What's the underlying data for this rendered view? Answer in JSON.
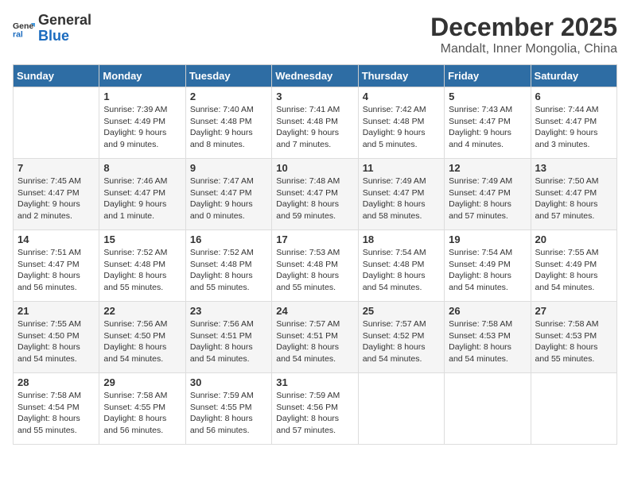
{
  "logo": {
    "general": "General",
    "blue": "Blue"
  },
  "title": "December 2025",
  "subtitle": "Mandalt, Inner Mongolia, China",
  "days_of_week": [
    "Sunday",
    "Monday",
    "Tuesday",
    "Wednesday",
    "Thursday",
    "Friday",
    "Saturday"
  ],
  "weeks": [
    [
      {
        "day": "",
        "info": ""
      },
      {
        "day": "1",
        "sunrise": "7:39 AM",
        "sunset": "4:49 PM",
        "daylight": "9 hours and 9 minutes."
      },
      {
        "day": "2",
        "sunrise": "7:40 AM",
        "sunset": "4:48 PM",
        "daylight": "9 hours and 8 minutes."
      },
      {
        "day": "3",
        "sunrise": "7:41 AM",
        "sunset": "4:48 PM",
        "daylight": "9 hours and 7 minutes."
      },
      {
        "day": "4",
        "sunrise": "7:42 AM",
        "sunset": "4:48 PM",
        "daylight": "9 hours and 5 minutes."
      },
      {
        "day": "5",
        "sunrise": "7:43 AM",
        "sunset": "4:47 PM",
        "daylight": "9 hours and 4 minutes."
      },
      {
        "day": "6",
        "sunrise": "7:44 AM",
        "sunset": "4:47 PM",
        "daylight": "9 hours and 3 minutes."
      }
    ],
    [
      {
        "day": "7",
        "sunrise": "7:45 AM",
        "sunset": "4:47 PM",
        "daylight": "9 hours and 2 minutes."
      },
      {
        "day": "8",
        "sunrise": "7:46 AM",
        "sunset": "4:47 PM",
        "daylight": "9 hours and 1 minute."
      },
      {
        "day": "9",
        "sunrise": "7:47 AM",
        "sunset": "4:47 PM",
        "daylight": "9 hours and 0 minutes."
      },
      {
        "day": "10",
        "sunrise": "7:48 AM",
        "sunset": "4:47 PM",
        "daylight": "8 hours and 59 minutes."
      },
      {
        "day": "11",
        "sunrise": "7:49 AM",
        "sunset": "4:47 PM",
        "daylight": "8 hours and 58 minutes."
      },
      {
        "day": "12",
        "sunrise": "7:49 AM",
        "sunset": "4:47 PM",
        "daylight": "8 hours and 57 minutes."
      },
      {
        "day": "13",
        "sunrise": "7:50 AM",
        "sunset": "4:47 PM",
        "daylight": "8 hours and 57 minutes."
      }
    ],
    [
      {
        "day": "14",
        "sunrise": "7:51 AM",
        "sunset": "4:47 PM",
        "daylight": "8 hours and 56 minutes."
      },
      {
        "day": "15",
        "sunrise": "7:52 AM",
        "sunset": "4:48 PM",
        "daylight": "8 hours and 55 minutes."
      },
      {
        "day": "16",
        "sunrise": "7:52 AM",
        "sunset": "4:48 PM",
        "daylight": "8 hours and 55 minutes."
      },
      {
        "day": "17",
        "sunrise": "7:53 AM",
        "sunset": "4:48 PM",
        "daylight": "8 hours and 55 minutes."
      },
      {
        "day": "18",
        "sunrise": "7:54 AM",
        "sunset": "4:48 PM",
        "daylight": "8 hours and 54 minutes."
      },
      {
        "day": "19",
        "sunrise": "7:54 AM",
        "sunset": "4:49 PM",
        "daylight": "8 hours and 54 minutes."
      },
      {
        "day": "20",
        "sunrise": "7:55 AM",
        "sunset": "4:49 PM",
        "daylight": "8 hours and 54 minutes."
      }
    ],
    [
      {
        "day": "21",
        "sunrise": "7:55 AM",
        "sunset": "4:50 PM",
        "daylight": "8 hours and 54 minutes."
      },
      {
        "day": "22",
        "sunrise": "7:56 AM",
        "sunset": "4:50 PM",
        "daylight": "8 hours and 54 minutes."
      },
      {
        "day": "23",
        "sunrise": "7:56 AM",
        "sunset": "4:51 PM",
        "daylight": "8 hours and 54 minutes."
      },
      {
        "day": "24",
        "sunrise": "7:57 AM",
        "sunset": "4:51 PM",
        "daylight": "8 hours and 54 minutes."
      },
      {
        "day": "25",
        "sunrise": "7:57 AM",
        "sunset": "4:52 PM",
        "daylight": "8 hours and 54 minutes."
      },
      {
        "day": "26",
        "sunrise": "7:58 AM",
        "sunset": "4:53 PM",
        "daylight": "8 hours and 54 minutes."
      },
      {
        "day": "27",
        "sunrise": "7:58 AM",
        "sunset": "4:53 PM",
        "daylight": "8 hours and 55 minutes."
      }
    ],
    [
      {
        "day": "28",
        "sunrise": "7:58 AM",
        "sunset": "4:54 PM",
        "daylight": "8 hours and 55 minutes."
      },
      {
        "day": "29",
        "sunrise": "7:58 AM",
        "sunset": "4:55 PM",
        "daylight": "8 hours and 56 minutes."
      },
      {
        "day": "30",
        "sunrise": "7:59 AM",
        "sunset": "4:55 PM",
        "daylight": "8 hours and 56 minutes."
      },
      {
        "day": "31",
        "sunrise": "7:59 AM",
        "sunset": "4:56 PM",
        "daylight": "8 hours and 57 minutes."
      },
      {
        "day": "",
        "info": ""
      },
      {
        "day": "",
        "info": ""
      },
      {
        "day": "",
        "info": ""
      }
    ]
  ]
}
